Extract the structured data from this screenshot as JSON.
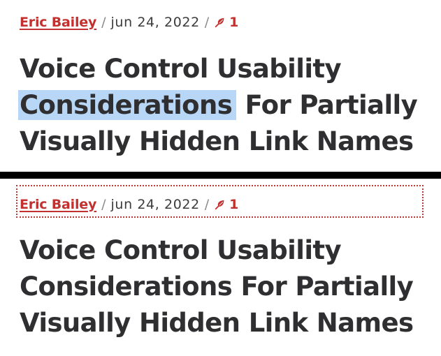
{
  "post": {
    "author": "Eric Bailey",
    "separator": "/",
    "date": "jun 24, 2022",
    "comment_count": "1",
    "title_line_1": "Voice Control Usability",
    "title_highlighted_word": "Considerations",
    "title_line_2_rest": " For Partially",
    "title_line_2_full": "Considerations For Partially",
    "title_line_3": "Visually Hidden Link Names"
  },
  "colors": {
    "link_red": "#c2312f",
    "heading": "#2f2f31",
    "selection_highlight": "#b8d6f5",
    "focus_outline": "#b83a34",
    "divider": "#000000"
  },
  "icons": {
    "comment": "leaf-icon"
  }
}
